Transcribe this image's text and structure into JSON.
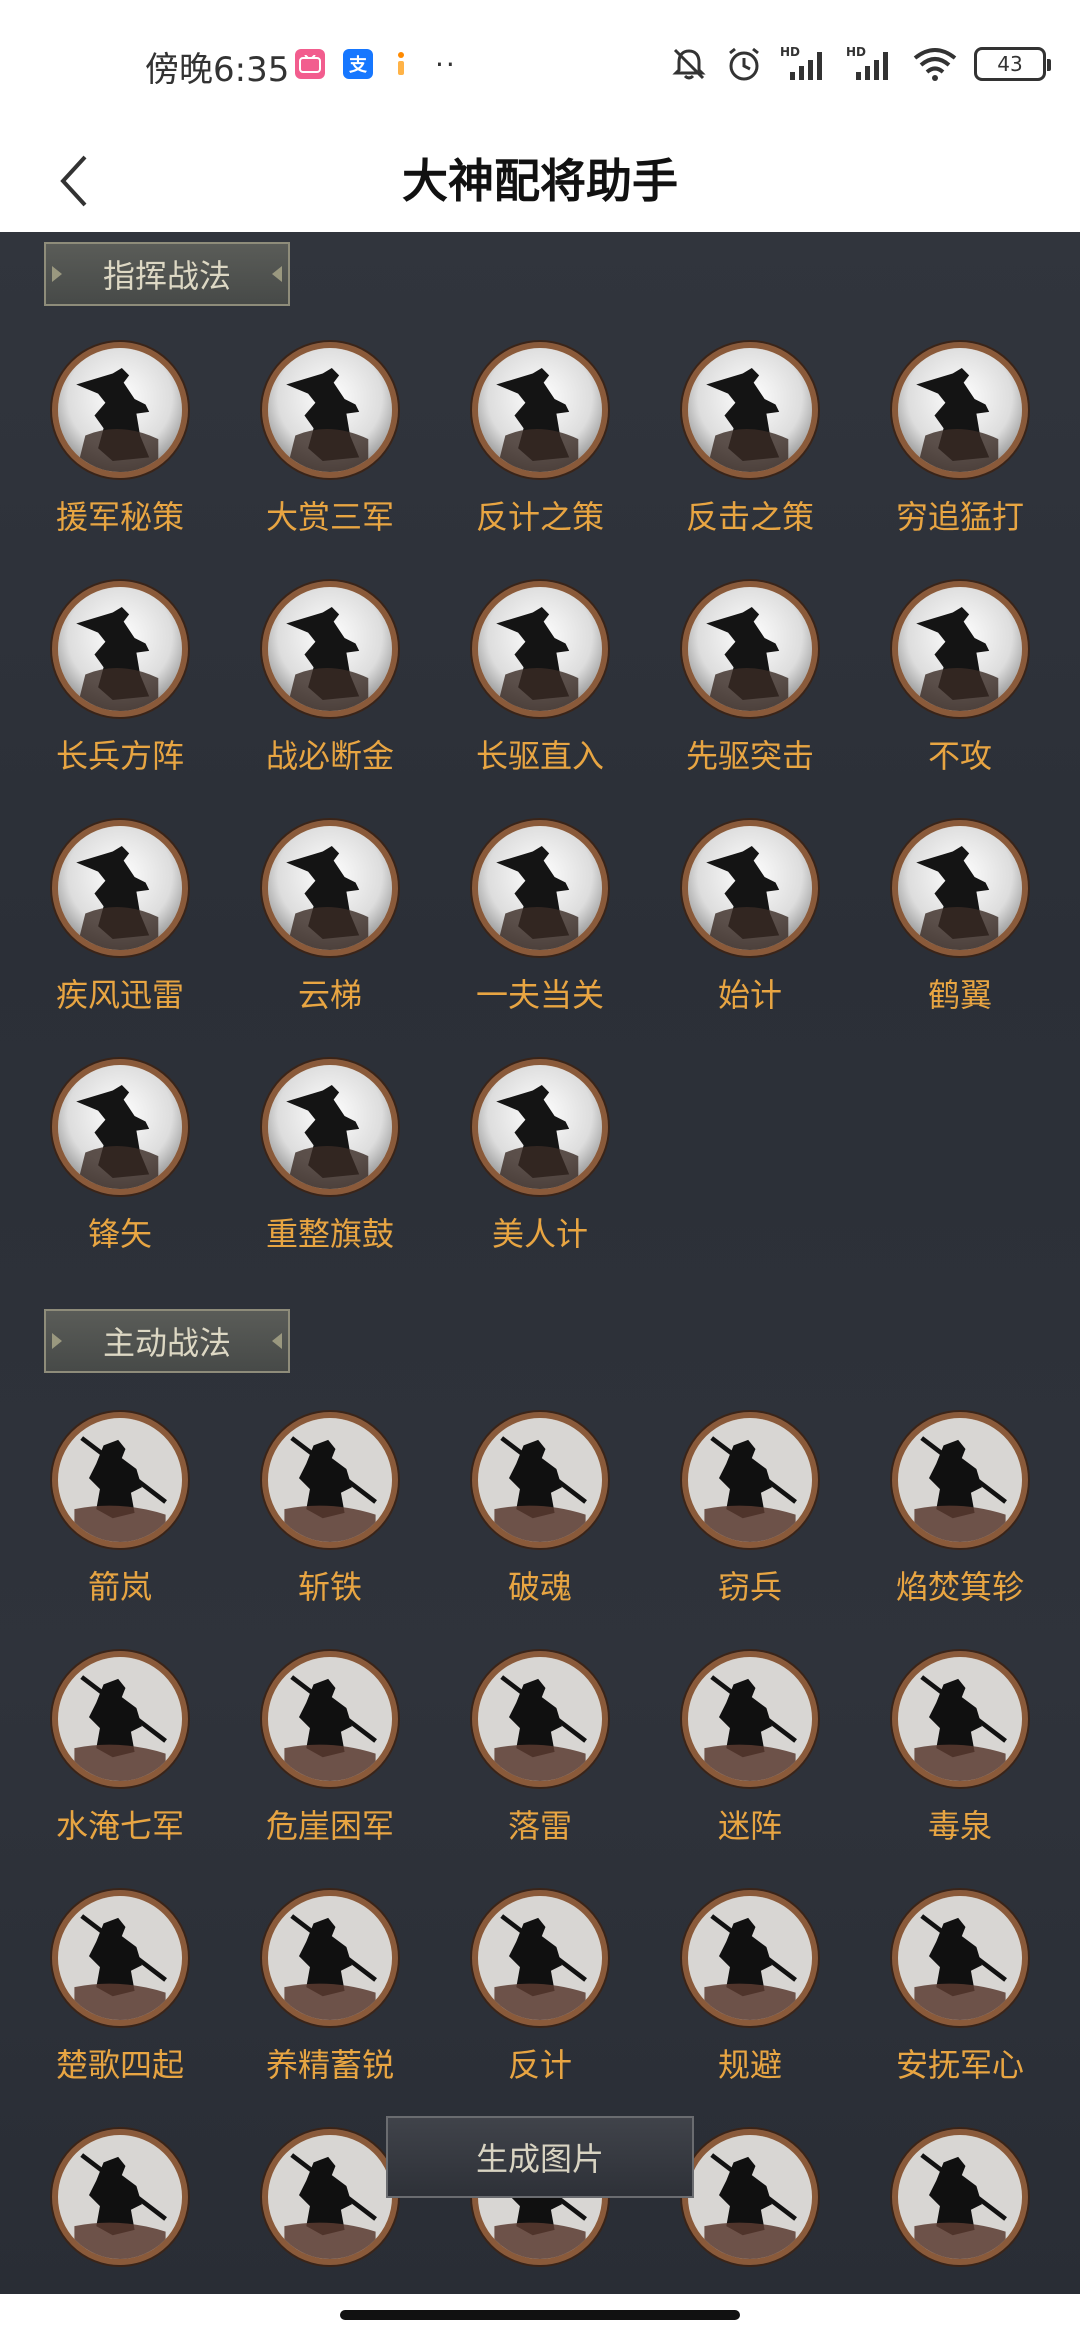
{
  "status_bar": {
    "time": "傍晚6:35",
    "app_icons": [
      {
        "name": "bilibili-icon",
        "glyph": "▶",
        "color": "#f25d8e"
      },
      {
        "name": "alipay-icon",
        "glyph": "支",
        "color": "#1677ff"
      },
      {
        "name": "taobao-icon",
        "glyph": "淘",
        "color": "#ff8a00"
      }
    ],
    "more": "··",
    "signal_1": "HD",
    "signal_2": "HD",
    "battery": "43"
  },
  "header": {
    "title": "大神配将助手"
  },
  "sections": [
    {
      "title": "指挥战法",
      "skills": [
        "援军秘策",
        "大赏三军",
        "反计之策",
        "反击之策",
        "穷追猛打",
        "长兵方阵",
        "战必断金",
        "长驱直入",
        "先驱突击",
        "不攻",
        "疾风迅雷",
        "云梯",
        "一夫当关",
        "始计",
        "鹤翼",
        "锋矢",
        "重整旗鼓",
        "美人计"
      ]
    },
    {
      "title": "主动战法",
      "skills": [
        "箭岚",
        "斩铁",
        "破魂",
        "窃兵",
        "焰焚箕轸",
        "水淹七军",
        "危崖困军",
        "落雷",
        "迷阵",
        "毒泉",
        "楚歌四起",
        "养精蓄锐",
        "反计",
        "规避",
        "安抚军心",
        "",
        "",
        "",
        "",
        ""
      ]
    }
  ],
  "generate_button": "生成图片",
  "colors": {
    "accent": "#e8a542",
    "background": "#2e323a",
    "icon_border": "#8a5a3a"
  }
}
